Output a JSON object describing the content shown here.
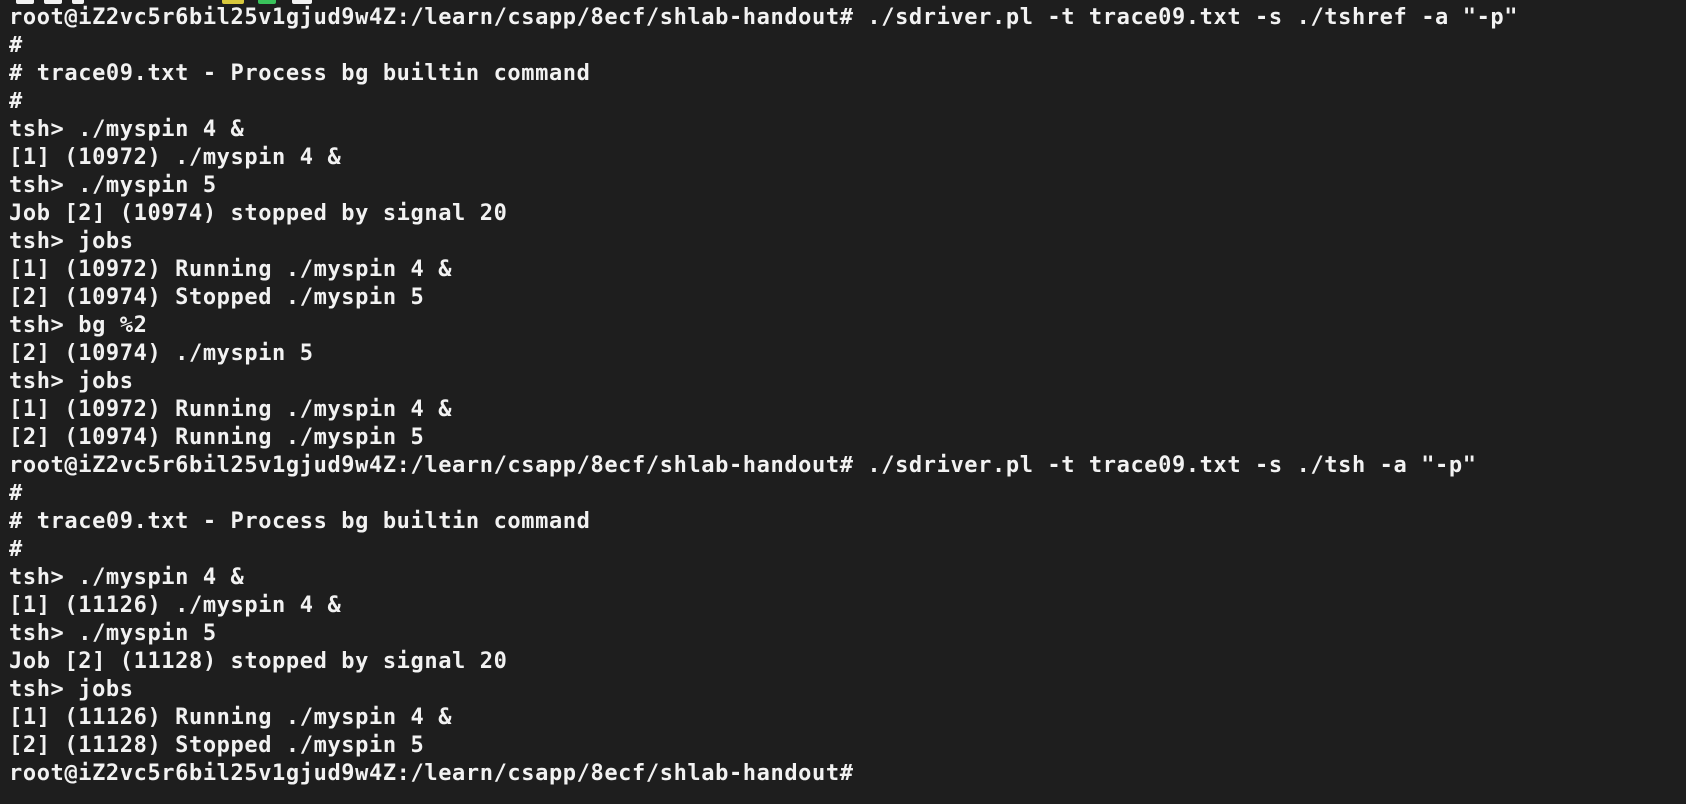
{
  "terminal": {
    "colors": {
      "background": "#1e1e1e",
      "text": "#f2f2f2",
      "top_fragment_yellow": "#d8c83c",
      "top_fragment_green": "#39c25b"
    },
    "lines": [
      "root@iZ2vc5r6bil25v1gjud9w4Z:/learn/csapp/8ecf/shlab-handout# ./sdriver.pl -t trace09.txt -s ./tshref -a \"-p\"",
      "#",
      "# trace09.txt - Process bg builtin command",
      "#",
      "tsh> ./myspin 4 &",
      "[1] (10972) ./myspin 4 &",
      "tsh> ./myspin 5",
      "Job [2] (10974) stopped by signal 20",
      "tsh> jobs",
      "[1] (10972) Running ./myspin 4 &",
      "[2] (10974) Stopped ./myspin 5",
      "tsh> bg %2",
      "[2] (10974) ./myspin 5",
      "tsh> jobs",
      "[1] (10972) Running ./myspin 4 &",
      "[2] (10974) Running ./myspin 5",
      "root@iZ2vc5r6bil25v1gjud9w4Z:/learn/csapp/8ecf/shlab-handout# ./sdriver.pl -t trace09.txt -s ./tsh -a \"-p\"",
      "#",
      "# trace09.txt - Process bg builtin command",
      "#",
      "tsh> ./myspin 4 &",
      "[1] (11126) ./myspin 4 &",
      "tsh> ./myspin 5",
      "Job [2] (11128) stopped by signal 20",
      "tsh> jobs",
      "[1] (11126) Running ./myspin 4 &",
      "[2] (11128) Stopped ./myspin 5",
      "root@iZ2vc5r6bil25v1gjud9w4Z:/learn/csapp/8ecf/shlab-handout#"
    ]
  }
}
